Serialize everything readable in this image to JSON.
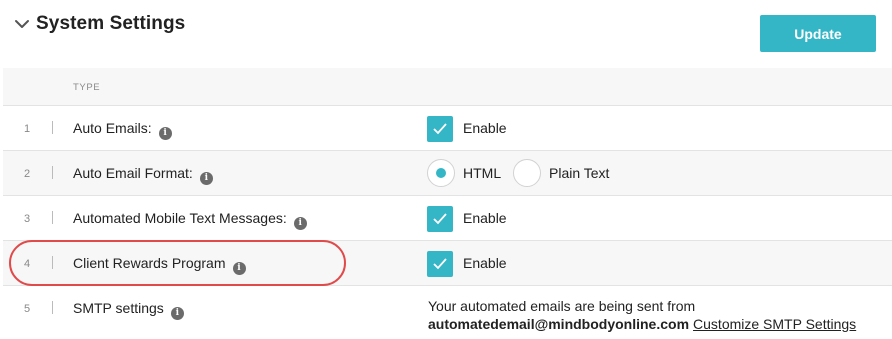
{
  "header": {
    "title": "System Settings",
    "update_label": "Update"
  },
  "table": {
    "column_header": "TYPE",
    "rows": [
      {
        "num": "1",
        "label": "Auto Emails:",
        "enable_label": "Enable",
        "checked": true
      },
      {
        "num": "2",
        "label": "Auto Email Format:",
        "options": [
          "HTML",
          "Plain Text"
        ],
        "selected": "HTML"
      },
      {
        "num": "3",
        "label": "Automated Mobile Text Messages:",
        "enable_label": "Enable",
        "checked": true
      },
      {
        "num": "4",
        "label": "Client Rewards Program",
        "enable_label": "Enable",
        "checked": true
      },
      {
        "num": "5",
        "label": "SMTP settings",
        "text": "Your automated emails are being sent from",
        "email": "automatedemail@mindbodyonline.com",
        "link": "Customize SMTP Settings"
      }
    ]
  },
  "info_glyph": "i",
  "colors": {
    "accent": "#35b6c6",
    "highlight": "#e04a4a",
    "row_alt": "#f7f7f7"
  }
}
